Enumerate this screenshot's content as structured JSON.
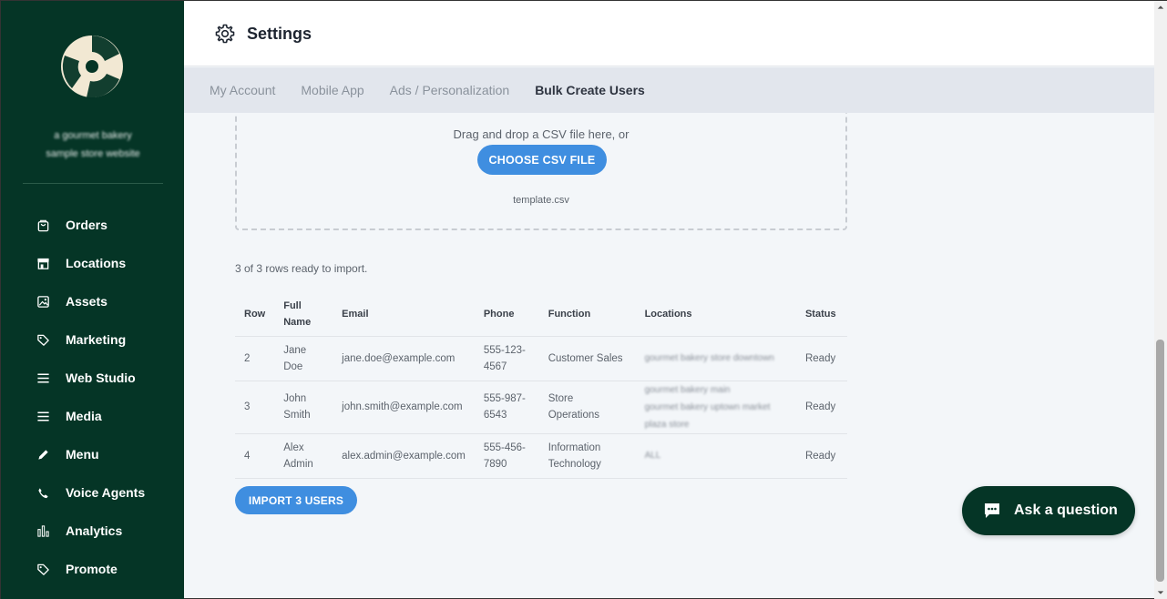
{
  "sidebar": {
    "account_name_line1": "a gourmet bakery",
    "account_name_line2": "sample store website",
    "items": [
      {
        "label": "Orders",
        "icon": "shopping-bag-icon"
      },
      {
        "label": "Locations",
        "icon": "storefront-icon"
      },
      {
        "label": "Assets",
        "icon": "image-icon"
      },
      {
        "label": "Marketing",
        "icon": "tag-icon"
      },
      {
        "label": "Web Studio",
        "icon": "menu-lines-icon"
      },
      {
        "label": "Media",
        "icon": "menu-lines-icon"
      },
      {
        "label": "Menu",
        "icon": "pencil-icon"
      },
      {
        "label": "Voice Agents",
        "icon": "phone-icon"
      },
      {
        "label": "Analytics",
        "icon": "bar-chart-icon"
      },
      {
        "label": "Promote",
        "icon": "tag-icon"
      }
    ]
  },
  "header": {
    "title": "Settings",
    "icon": "gear-icon"
  },
  "tabs": [
    {
      "label": "My Account",
      "active": false
    },
    {
      "label": "Mobile App",
      "active": false
    },
    {
      "label": "Ads / Personalization",
      "active": false
    },
    {
      "label": "Bulk Create Users",
      "active": true
    }
  ],
  "upload": {
    "prompt": "Drag and drop a CSV file here, or",
    "choose_label": "CHOOSE CSV FILE",
    "template_link": "template.csv"
  },
  "rows_ready": "3 of 3 rows ready to import.",
  "table": {
    "headers": {
      "row": "Row",
      "full_name_1": "Full",
      "full_name_2": "Name",
      "email": "Email",
      "phone": "Phone",
      "function": "Function",
      "locations": "Locations",
      "status": "Status"
    },
    "rows": [
      {
        "row": "2",
        "name1": "Jane",
        "name2": "Doe",
        "email": "jane.doe@example.com",
        "phone1": "555-123-",
        "phone2": "4567",
        "func1": "Customer Sales",
        "func2": "",
        "loc1": "gourmet bakery store downtown",
        "loc2": "",
        "status": "Ready"
      },
      {
        "row": "3",
        "name1": "John",
        "name2": "Smith",
        "email": "john.smith@example.com",
        "phone1": "555-987-",
        "phone2": "6543",
        "func1": "Store",
        "func2": "Operations",
        "loc1": "gourmet bakery main",
        "loc2": "gourmet bakery uptown market plaza store",
        "status": "Ready"
      },
      {
        "row": "4",
        "name1": "Alex",
        "name2": "Admin",
        "email": "alex.admin@example.com",
        "phone1": "555-456-",
        "phone2": "7890",
        "func1": "Information",
        "func2": "Technology",
        "loc1": "ALL",
        "loc2": "",
        "status": "Ready"
      }
    ]
  },
  "import_label": "IMPORT 3 USERS",
  "ask": {
    "label": "Ask a question",
    "icon": "chat-bubble-icon"
  },
  "colors": {
    "sidebar": "#053526",
    "accent": "#3f8ee0",
    "tabs_bg": "#e2e6ed",
    "content_bg": "#f3f6f9"
  }
}
